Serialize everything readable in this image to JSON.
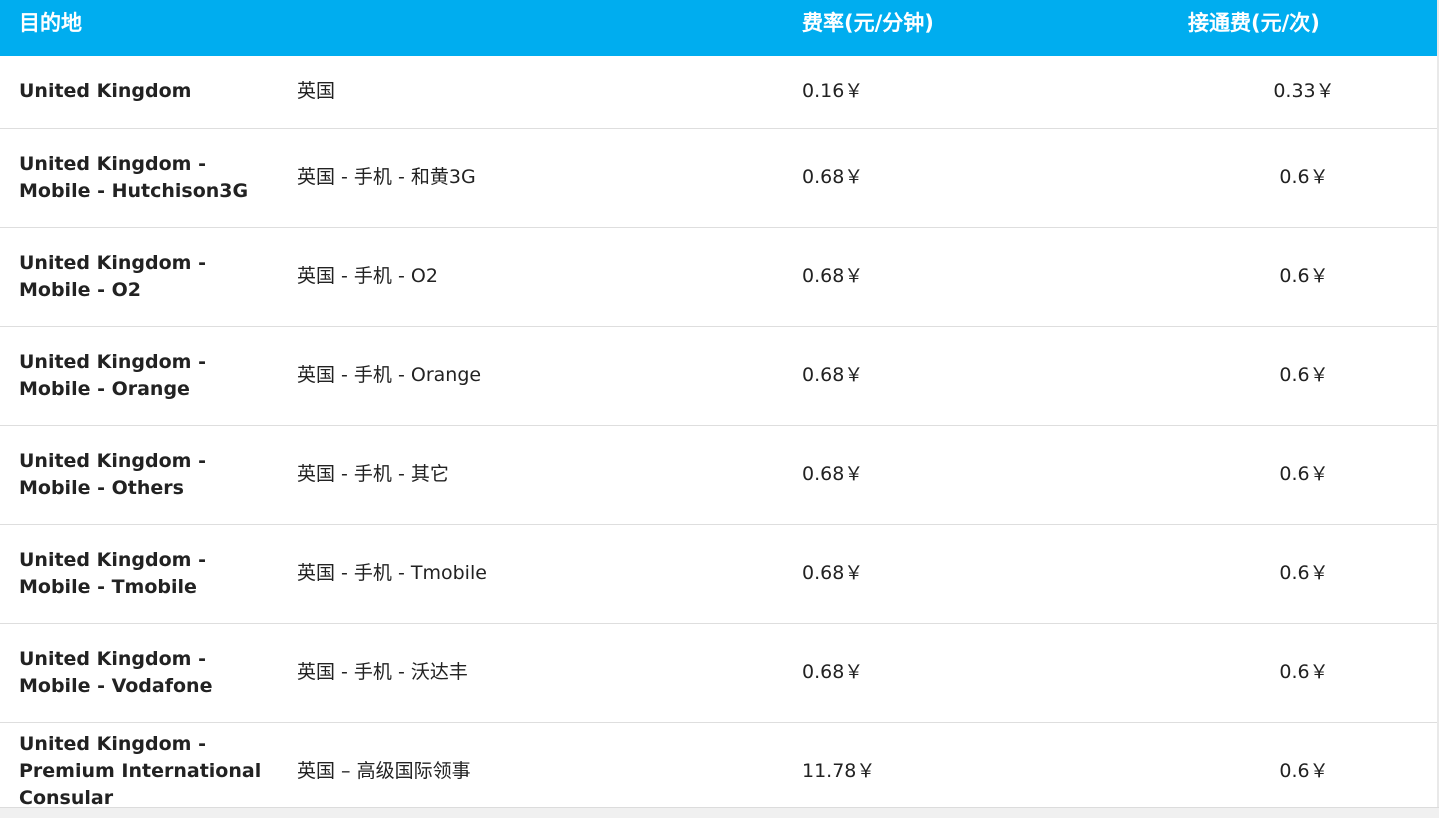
{
  "header": {
    "destination": "目的地",
    "rate": "费率(元/分钟)",
    "connection_fee": "接通费(元/次)"
  },
  "rows": [
    {
      "destination": "United Kingdom",
      "chinese": "英国",
      "rate": "0.16￥",
      "connection_fee": "0.33￥"
    },
    {
      "destination": "United Kingdom - Mobile - Hutchison3G",
      "chinese": "英国 - 手机 - 和黄3G",
      "rate": "0.68￥",
      "connection_fee": "0.6￥"
    },
    {
      "destination": "United Kingdom - Mobile - O2",
      "chinese": "英国 - 手机 - O2",
      "rate": "0.68￥",
      "connection_fee": "0.6￥"
    },
    {
      "destination": "United Kingdom - Mobile - Orange",
      "chinese": "英国 - 手机 - Orange",
      "rate": "0.68￥",
      "connection_fee": "0.6￥"
    },
    {
      "destination": "United Kingdom - Mobile - Others",
      "chinese": "英国 - 手机 - 其它",
      "rate": "0.68￥",
      "connection_fee": "0.6￥"
    },
    {
      "destination": "United Kingdom - Mobile - Tmobile",
      "chinese": "英国 - 手机 - Tmobile",
      "rate": "0.68￥",
      "connection_fee": "0.6￥"
    },
    {
      "destination": "United Kingdom - Mobile - Vodafone",
      "chinese": "英国 - 手机 - 沃达丰",
      "rate": "0.68￥",
      "connection_fee": "0.6￥"
    },
    {
      "destination": "United Kingdom - Premium International Consular",
      "chinese": "英国 – 高级国际领事",
      "rate": "11.78￥",
      "connection_fee": "0.6￥"
    }
  ],
  "colors": {
    "header_background": "#00adef",
    "header_text": "#ffffff",
    "row_divider": "#dedede"
  }
}
